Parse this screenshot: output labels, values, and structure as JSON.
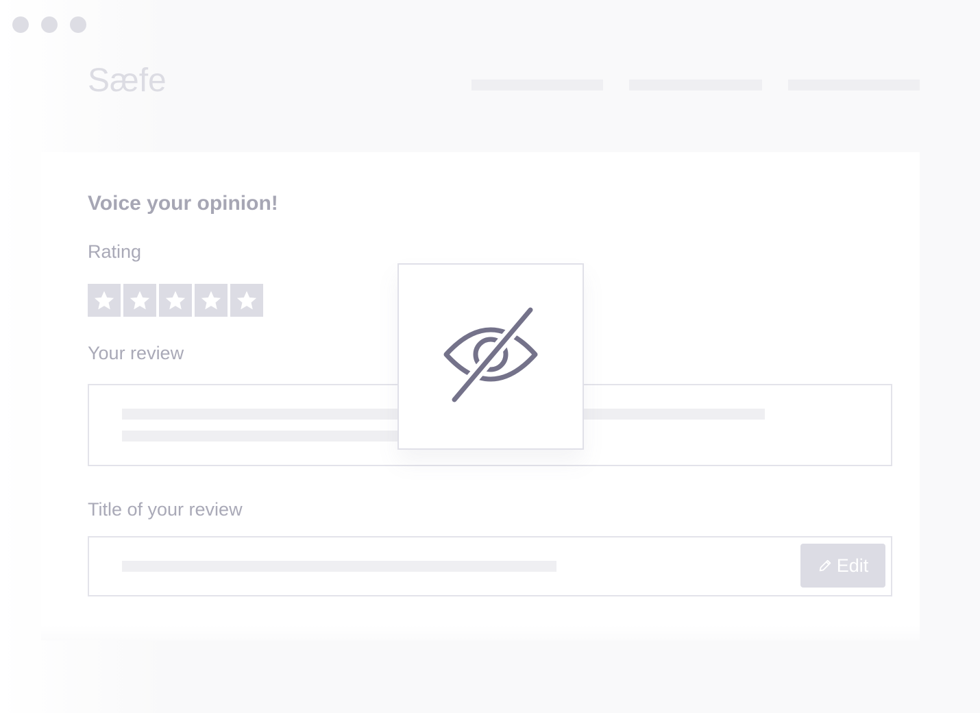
{
  "window": {
    "controls": [
      "window-dot",
      "window-dot",
      "window-dot"
    ]
  },
  "header": {
    "logo": "Sæfe",
    "nav_placeholders": 3
  },
  "form": {
    "heading": "Voice your opinion!",
    "rating_label": "Rating",
    "rating_max": 5,
    "review_label": "Your review",
    "title_label": "Title of your review",
    "edit_button_label": "Edit"
  },
  "overlay": {
    "icon": "eye-slash-icon"
  },
  "colors": {
    "text_muted": "#a6a6b4",
    "placeholder": "#dcdce4",
    "skeleton": "#efeff2",
    "icon": "#74728a",
    "border": "#e3e3ea"
  }
}
